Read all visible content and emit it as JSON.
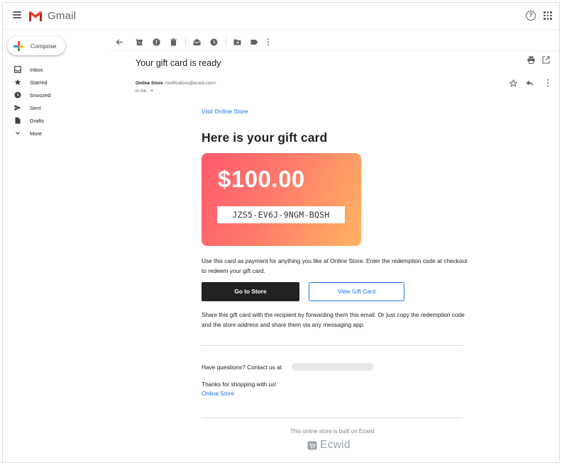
{
  "app": {
    "name": "Gmail"
  },
  "sidebar": {
    "compose_label": "Compose",
    "items": [
      {
        "label": "Inbox",
        "icon": "inbox-icon"
      },
      {
        "label": "Starred",
        "icon": "star-icon"
      },
      {
        "label": "Snoozed",
        "icon": "clock-icon"
      },
      {
        "label": "Sent",
        "icon": "send-icon"
      },
      {
        "label": "Drafts",
        "icon": "draft-icon"
      },
      {
        "label": "More",
        "icon": "chevron-down-icon"
      }
    ]
  },
  "toolbar": {
    "icons": [
      "back-icon",
      "archive-icon",
      "report-spam-icon",
      "delete-icon",
      "mark-unread-icon",
      "snooze-icon",
      "move-to-icon",
      "label-icon",
      "more-vert-icon"
    ]
  },
  "message": {
    "subject": "Your gift card is ready",
    "sender_name": "Online Store",
    "sender_address": "<notifications@ecwid.com>",
    "to_me": "to me"
  },
  "email": {
    "visit_link": "Visit Online Store",
    "heading": "Here is your gift card",
    "card": {
      "amount": "$100.00",
      "code": "JZS5-EV6J-9NGM-BQSH",
      "gradient_start": "#ff5a6e",
      "gradient_end": "#ffb562"
    },
    "paragraph1": "Use this card as payment for anything you like at Online Store. Enter the redemption code at checkout to redeem your gift card.",
    "button_store": "Go to Store",
    "button_view": "View Gift Card",
    "paragraph2": "Share this gift card with the recipient by forwarding them this email. Or just copy the redemption code and the store address and share them via any messaging app.",
    "questions": "Have questions? Contact us at",
    "thanks": "Thanks for shopping with us!",
    "store_link": "Online Store",
    "built_on": "This online store is built on Ecwid",
    "brand": "Ecwid"
  },
  "colors": {
    "accent": "#1a73e8",
    "dark_button": "#222222"
  }
}
